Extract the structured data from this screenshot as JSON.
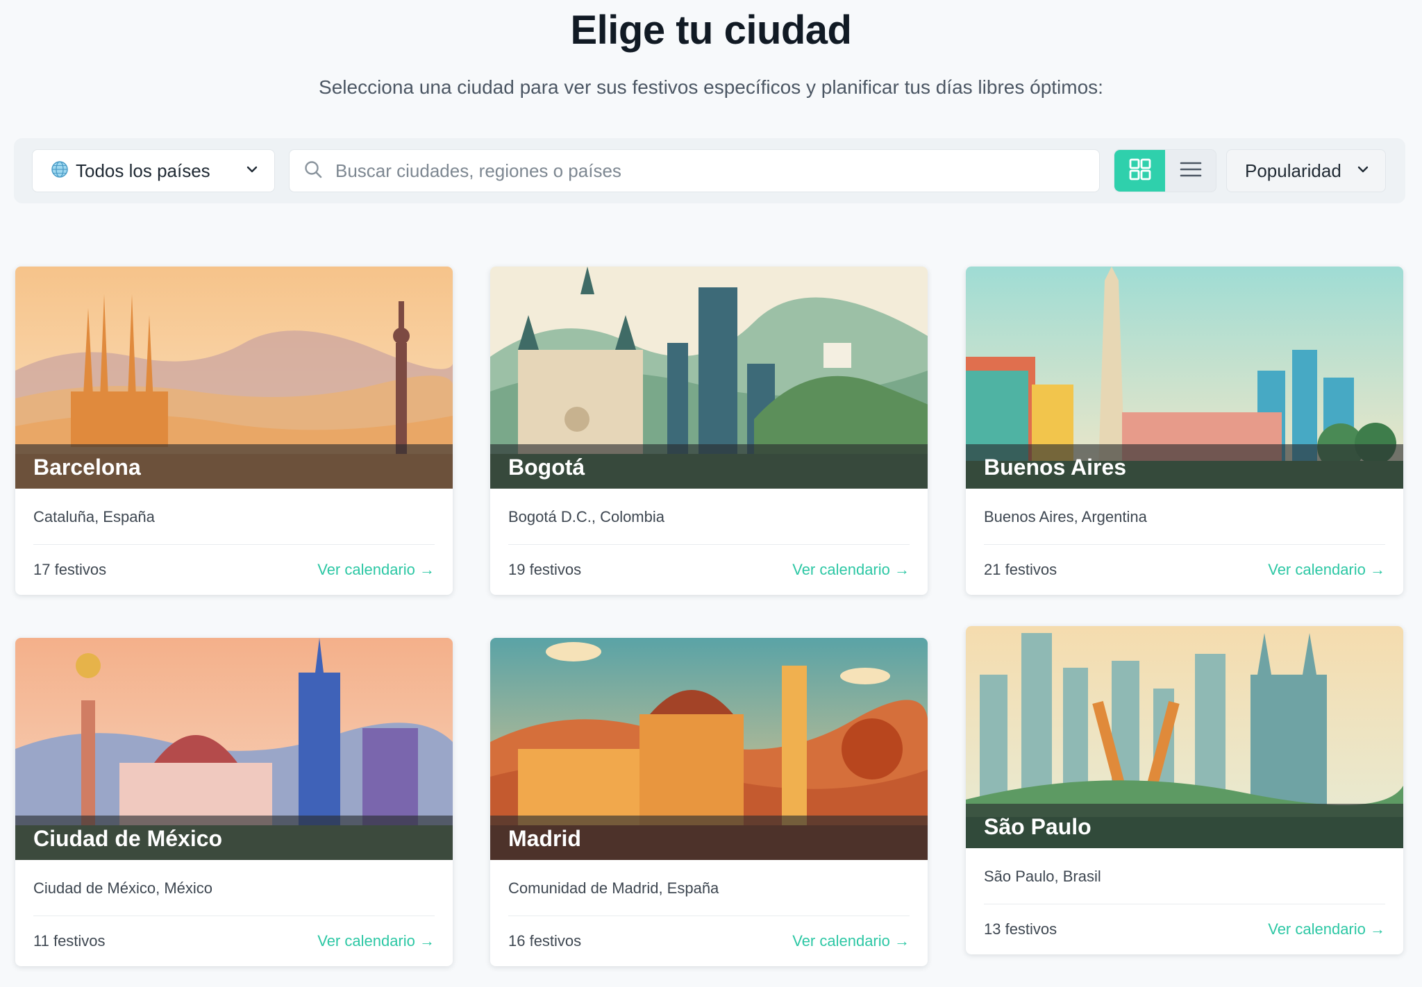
{
  "header": {
    "title": "Elige tu ciudad",
    "subtitle": "Selecciona una ciudad para ver sus festivos específicos y planificar tus días libres óptimos:"
  },
  "toolbar": {
    "country_filter": "Todos los países",
    "search_placeholder": "Buscar ciudades, regiones o países",
    "sort_label": "Popularidad",
    "active_view": "grid"
  },
  "accent_color": "#2fd0ac",
  "cities": [
    {
      "name": "Barcelona",
      "region": "Cataluña, España",
      "holidays": "17 festivos",
      "link": "Ver calendario →"
    },
    {
      "name": "Bogotá",
      "region": "Bogotá D.C., Colombia",
      "holidays": "19 festivos",
      "link": "Ver calendario →"
    },
    {
      "name": "Buenos Aires",
      "region": "Buenos Aires, Argentina",
      "holidays": "21 festivos",
      "link": "Ver calendario →"
    },
    {
      "name": "Ciudad de México",
      "region": "Ciudad de México, México",
      "holidays": "11 festivos",
      "link": "Ver calendario →"
    },
    {
      "name": "Madrid",
      "region": "Comunidad de Madrid, España",
      "holidays": "16 festivos",
      "link": "Ver calendario →"
    },
    {
      "name": "São Paulo",
      "region": "São Paulo, Brasil",
      "holidays": "13 festivos",
      "link": "Ver calendario →"
    }
  ]
}
